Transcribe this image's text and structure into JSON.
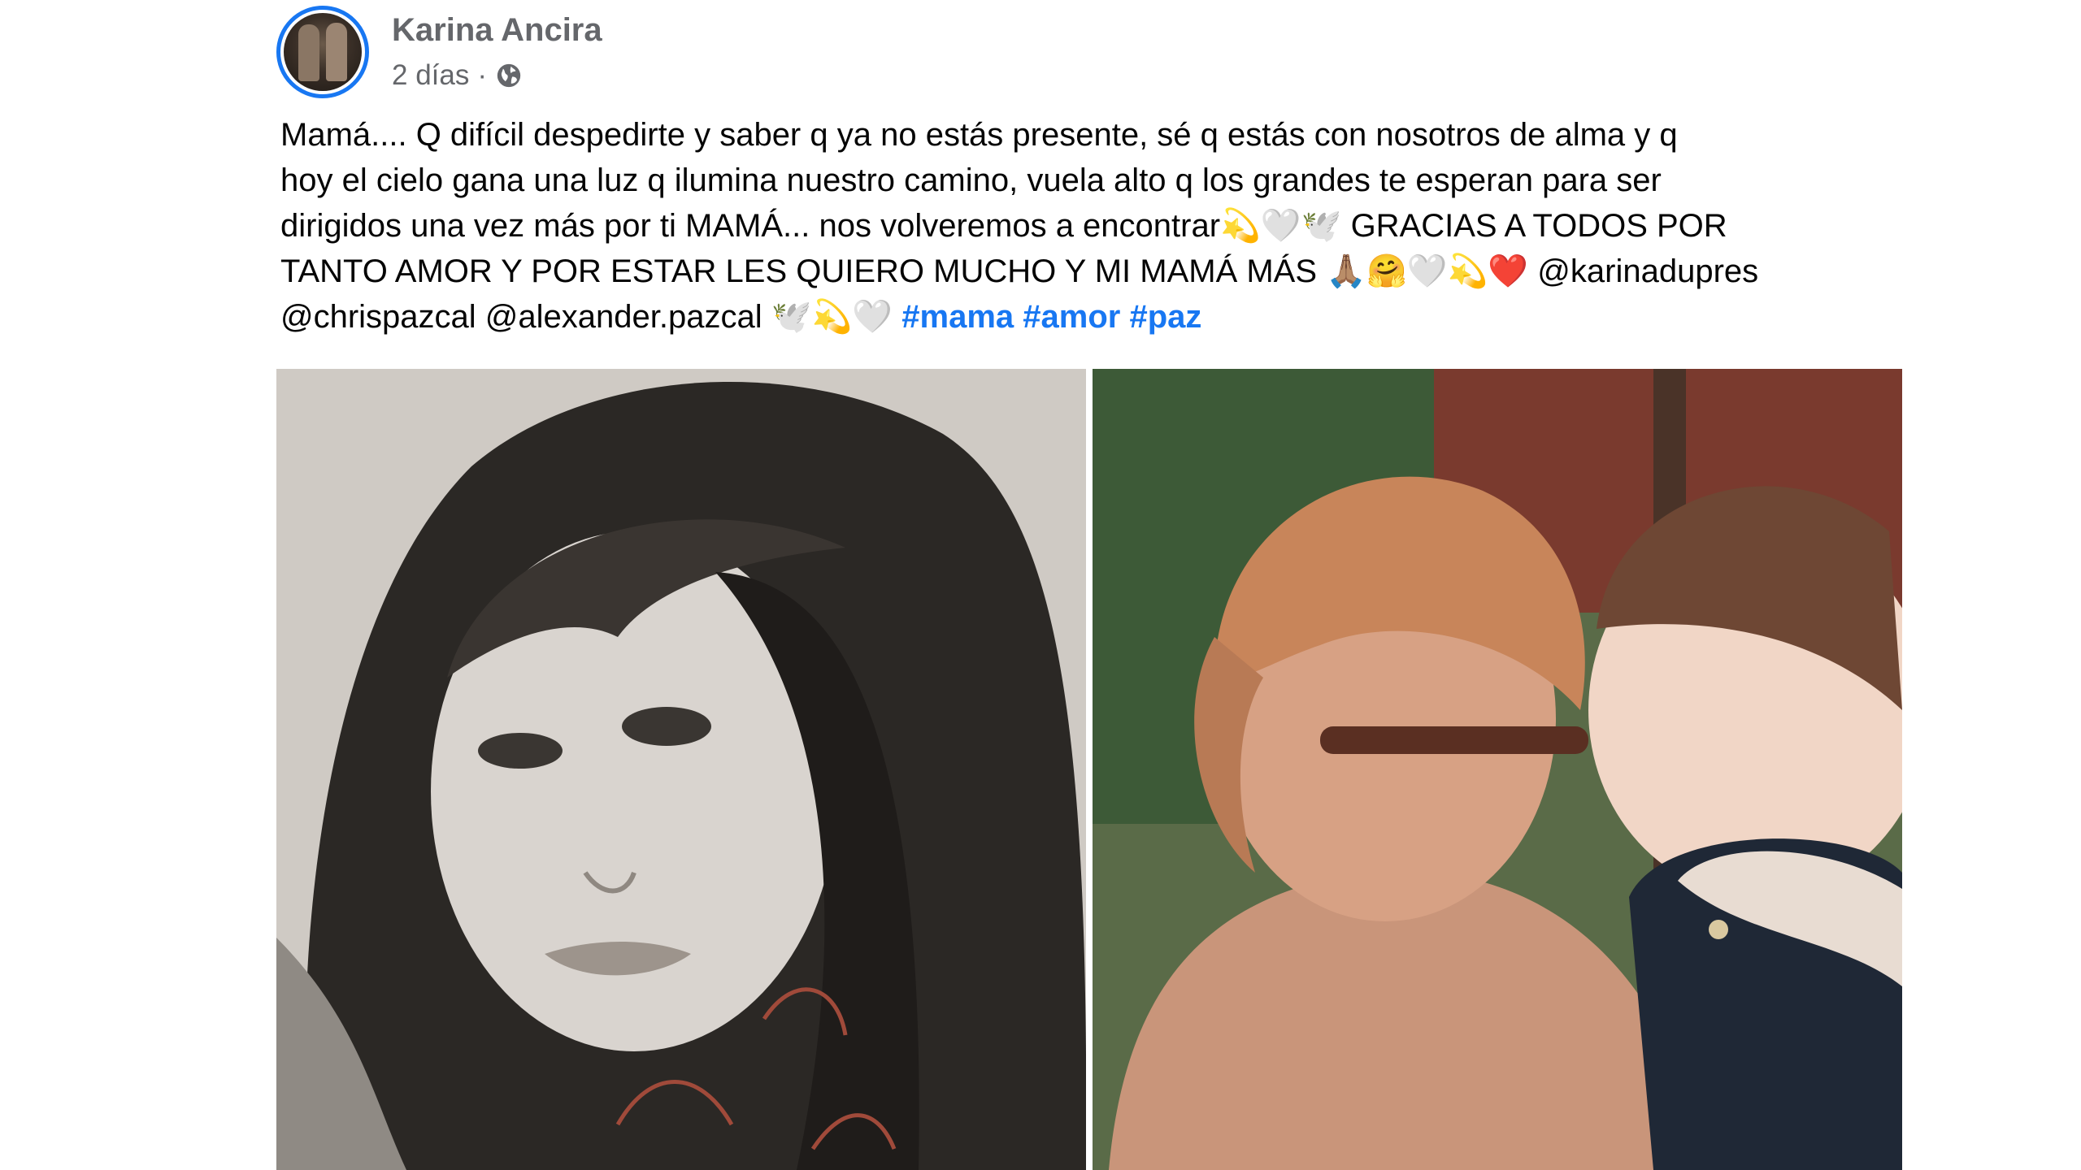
{
  "post": {
    "author": "Karina Ancira",
    "time": "2 días",
    "separator": "·",
    "privacy_icon": "globe-icon",
    "caption_lines": [
      "Mamá.... Q difícil despedirte y saber q ya no estás presente, sé q estás con nosotros de alma y q",
      "hoy el cielo gana una luz q ilumina nuestro camino, vuela alto q los grandes te esperan para ser",
      "dirigidos una vez más por ti MAMÁ... nos volveremos a encontrar💫🤍🕊️ GRACIAS A TODOS POR",
      "TANTO AMOR Y POR ESTAR LES QUIERO MUCHO Y MI MAMÁ MÁS 🙏🏽🤗🤍💫❤️ @karinadupres",
      "@chrispazcal @alexander.pazcal 🕊️💫🤍 "
    ],
    "hashtags": [
      "#mama",
      "#amor",
      "#paz"
    ],
    "accent_color": "#1877f2",
    "photos": [
      {
        "description": "black-and-white portrait photo"
      },
      {
        "description": "elderly woman with glasses touching foreheads with a baby"
      }
    ]
  }
}
